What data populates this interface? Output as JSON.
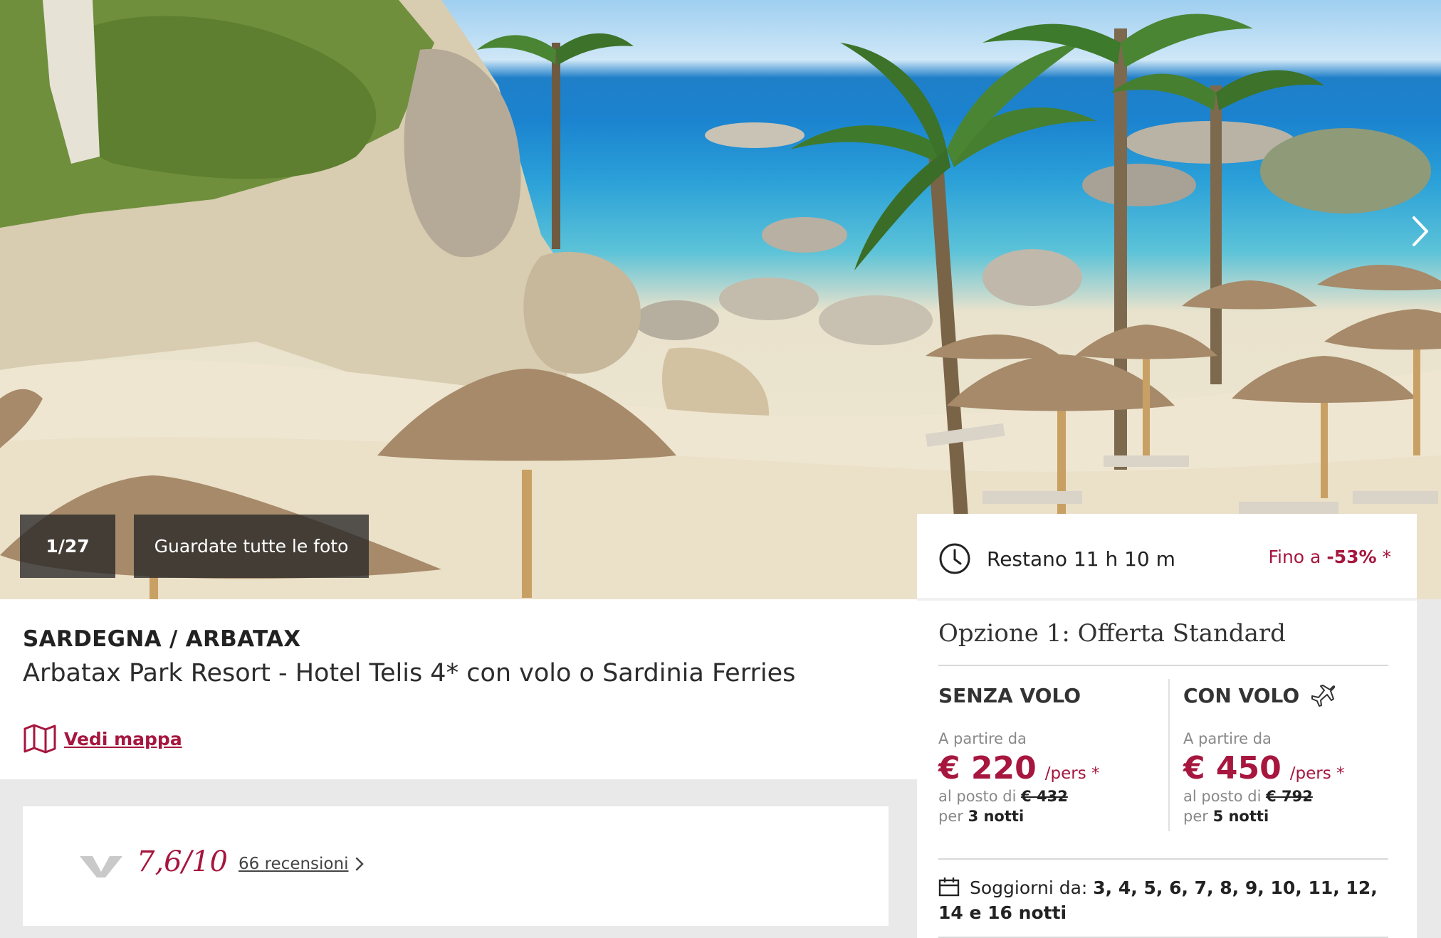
{
  "gallery": {
    "counter": "1/27",
    "all_photos_label": "Guardate tutte le foto"
  },
  "hotel": {
    "region": "SARDEGNA / ARBATAX",
    "name": "Arbatax Park Resort - Hotel Telis 4* con volo o Sardinia Ferries",
    "map_link": "Vedi mappa"
  },
  "reviews": {
    "rating": "7,6/10",
    "count_label": "66 recensioni"
  },
  "offer": {
    "timer_text": "Restano 11 h 10 m",
    "discount_prefix": "Fino a ",
    "discount_value": "-53%",
    "discount_suffix": " *",
    "option_title": "Opzione 1: Offerta Standard",
    "without_flight": {
      "title": "SENZA VOLO",
      "from_label": "A partire da",
      "price": "€ 220",
      "per": "/pers *",
      "instead_label": "al posto di ",
      "old_price": "€ 432",
      "nights_prefix": "per ",
      "nights": "3 notti"
    },
    "with_flight": {
      "title": "CON VOLO",
      "from_label": "A partire da",
      "price": "€ 450",
      "per": "/pers *",
      "instead_label": "al posto di ",
      "old_price": "€ 792",
      "nights_prefix": "per ",
      "nights": "5 notti"
    },
    "stays_label": "Soggiorni da: ",
    "stays_values": "3, 4, 5, 6, 7, 8, 9, 10, 11, 12, 14 e 16 notti"
  },
  "colors": {
    "accent": "#a6163e"
  },
  "icons": [
    "chevron-right-icon",
    "map-icon",
    "clock-icon",
    "airplane-icon",
    "calendar-icon",
    "brand-logo"
  ]
}
